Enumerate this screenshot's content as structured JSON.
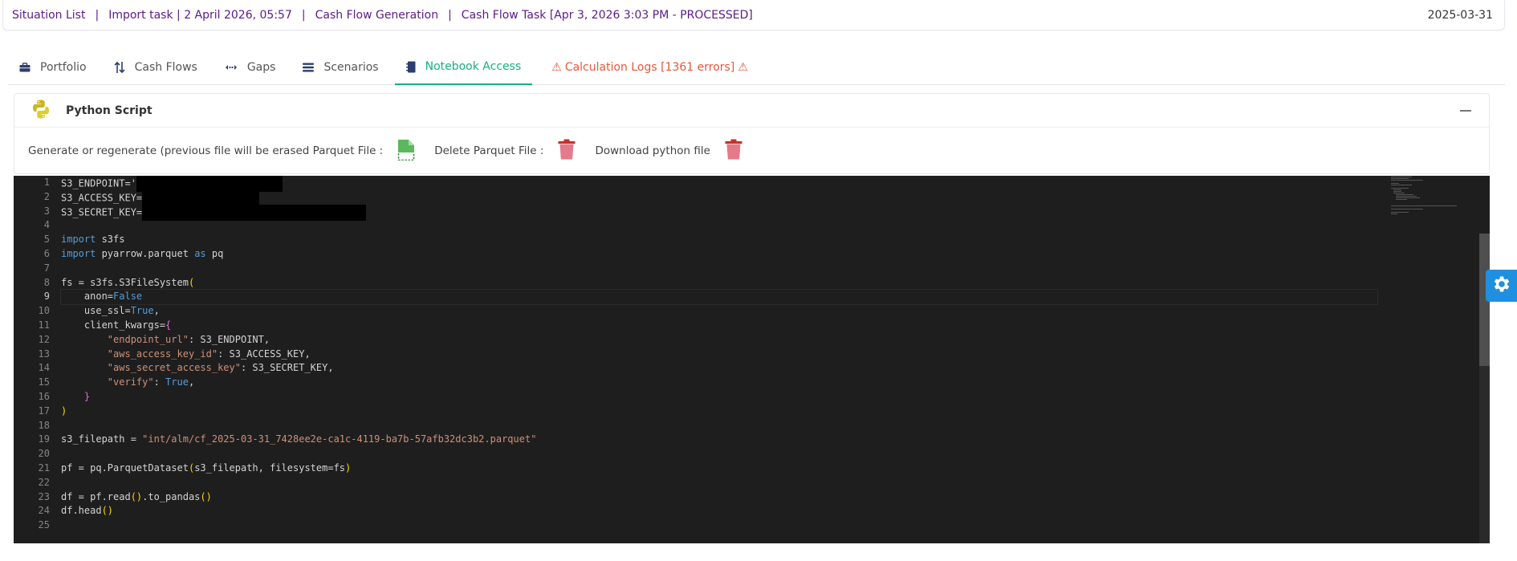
{
  "breadcrumb": [
    "Situation List",
    "Import task | 2 April 2026, 05:57",
    "Cash Flow Generation",
    "Cash Flow Task [Apr 3, 2026 3:03 PM - PROCESSED]"
  ],
  "breadcrumb_separator": "|",
  "date": "2025-03-31",
  "tabs": {
    "portfolio": "Portfolio",
    "cash_flows": "Cash Flows",
    "gaps": "Gaps",
    "scenarios": "Scenarios",
    "notebook_access": "Notebook Access",
    "calculation_logs": "Calculation Logs [1361 errors]"
  },
  "panel": {
    "title": "Python Script",
    "generate_label": "Generate or regenerate (previous file will be erased Parquet File :",
    "delete_label": "Delete Parquet File :",
    "download_label": "Download python file"
  },
  "code": {
    "line_numbers": [
      "1",
      "2",
      "3",
      "4",
      "5",
      "6",
      "7",
      "8",
      "9",
      "10",
      "11",
      "12",
      "13",
      "14",
      "15",
      "16",
      "17",
      "18",
      "19",
      "20",
      "21",
      "22",
      "23",
      "24",
      "25"
    ],
    "l1": "S3_ENDPOINT='",
    "l2": "S3_ACCESS_KEY=",
    "l3": "S3_SECRET_KEY=",
    "import_kw": "import",
    "as_kw": "as",
    "mod_s3fs": " s3fs",
    "mod_pq": " pyarrow.parquet ",
    "alias_pq": " pq",
    "l8": "fs = s3fs.S3FileSystem",
    "anon": "    anon=",
    "false_kw": "False",
    "use_ssl": "    use_ssl=",
    "true_kw": "True",
    "client_kwargs": "    client_kwargs=",
    "k_endpoint": "\"endpoint_url\"",
    "v_endpoint": ": S3_ENDPOINT,",
    "k_access": "\"aws_access_key_id\"",
    "v_access": ": S3_ACCESS_KEY,",
    "k_secret": "\"aws_secret_access_key\"",
    "v_secret": ": S3_SECRET_KEY,",
    "k_verify": "\"verify\"",
    "l19_a": "s3_filepath = ",
    "l19_s": "\"int/alm/cf_2025-03-31_7428ee2e-ca1c-4119-ba7b-57afb32dc3b2.parquet\"",
    "l21": "pf = pq.ParquetDataset",
    "l21_args": "s3_filepath, filesystem=fs",
    "l23_a": "df = pf.read",
    "l23_b": ".to_pandas",
    "l24": "df.head"
  },
  "colors": {
    "breadcrumb": "#5a1a8c",
    "tab_active": "#17b17a",
    "tab_error": "#e8563a",
    "editor_bg": "#1e1e1e",
    "keyword": "#569cd6",
    "string": "#ce9178",
    "bracket_1": "#ffd700",
    "bracket_2": "#da70d6",
    "settings_button": "#1f8fe0"
  },
  "icons": {
    "portfolio": "briefcase-icon",
    "cash_flows": "up-down-arrows-icon",
    "gaps": "gap-arrows-icon",
    "scenarios": "list-icon",
    "notebook_access": "notebook-icon",
    "calculation_logs": "warning-icon",
    "panel": "python-logo-icon",
    "generate": "file-icon",
    "delete": "trash-icon",
    "download": "trash-icon",
    "settings": "gear-icon"
  }
}
